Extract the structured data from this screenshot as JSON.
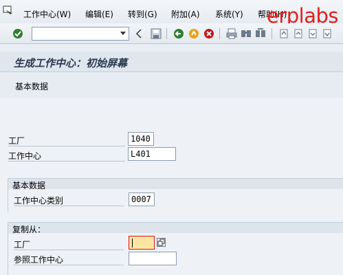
{
  "menu": {
    "items": [
      "工作中心(W)",
      "编辑(E)",
      "转到(G)",
      "附加(A)",
      "系统(Y)",
      "帮助(H)"
    ]
  },
  "watermark": "erplabs",
  "toolbar": {
    "command_value": ""
  },
  "title": "生成工作中心：初始屏幕",
  "appbar": {
    "basic_data_button": "基本数据"
  },
  "form": {
    "plant_label": "工厂",
    "plant_value": "1040",
    "workcenter_label": "工作中心",
    "workcenter_value": "L401"
  },
  "basic_group": {
    "title": "基本数据",
    "category_label": "工作中心类别",
    "category_value": "0007"
  },
  "copy_group": {
    "title": "复制从：",
    "plant_label": "工厂",
    "plant_value": "",
    "ref_workcenter_label": "参照工作中心",
    "ref_workcenter_value": ""
  },
  "colors": {
    "title": "#2b3a4f",
    "accent_error": "#dd1111",
    "watermark": "#e0201c"
  }
}
